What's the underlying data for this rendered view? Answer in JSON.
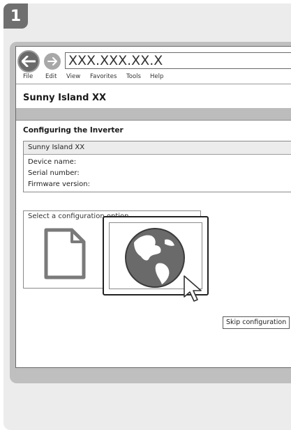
{
  "step": {
    "number": "1"
  },
  "browser": {
    "address": "XXX.XXX.XX.X",
    "menu": [
      "File",
      "Edit",
      "View",
      "Favorites",
      "Tools",
      "Help"
    ]
  },
  "app": {
    "title": "Sunny Island XX"
  },
  "inverter": {
    "section_title": "Configuring the Inverter",
    "device_header": "Sunny Island XX",
    "fields": [
      "Device name:",
      "Serial number:",
      "Firmware version:"
    ]
  },
  "config": {
    "label": "Select a configuration option",
    "options": [
      "document-icon",
      "globe-icon"
    ],
    "skip_label": "Skip configuration"
  },
  "colors": {
    "frame": "#6a6a6a",
    "panel": "#ececec",
    "strip": "#bcbcbc"
  }
}
